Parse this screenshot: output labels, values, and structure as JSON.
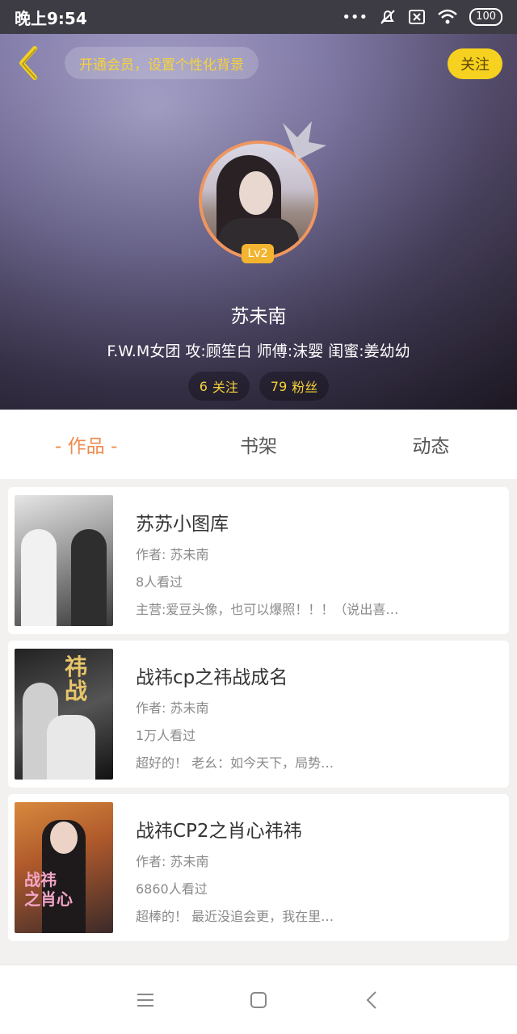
{
  "status_bar": {
    "time": "晚上9:54",
    "battery": "100"
  },
  "header": {
    "vip_prompt": "开通会员，设置个性化背景",
    "follow_label": "关注"
  },
  "profile": {
    "level": "Lv2",
    "name": "苏未南",
    "bio": "F.W.M女团  攻:顾笙白  师傅:沫婴  闺蜜:姜幼幼",
    "following_count": "6",
    "following_label": "关注",
    "followers_count": "79",
    "followers_label": "粉丝"
  },
  "tabs": [
    {
      "label": "- 作品 -",
      "active": true
    },
    {
      "label": "书架",
      "active": false
    },
    {
      "label": "动态",
      "active": false
    }
  ],
  "works": [
    {
      "title": "苏苏小图库",
      "author": "作者: 苏未南",
      "views": "8人看过",
      "desc": "主营:爱豆头像，也可以爆照！！！（说出喜…"
    },
    {
      "title": "战祎cp之祎战成名",
      "author": "作者: 苏未南",
      "views": "1万人看过",
      "desc": "超好的！ 老幺：如今天下，局势…"
    },
    {
      "title": "战祎CP2之肖心祎祎",
      "author": "作者: 苏未南",
      "views": "6860人看过",
      "desc": "超棒的！ 最近没追会更，我在里…"
    }
  ],
  "colors": {
    "accent": "#ee8a4c",
    "follow_yellow": "#f7d11f",
    "vip_text": "#f6d23a"
  }
}
